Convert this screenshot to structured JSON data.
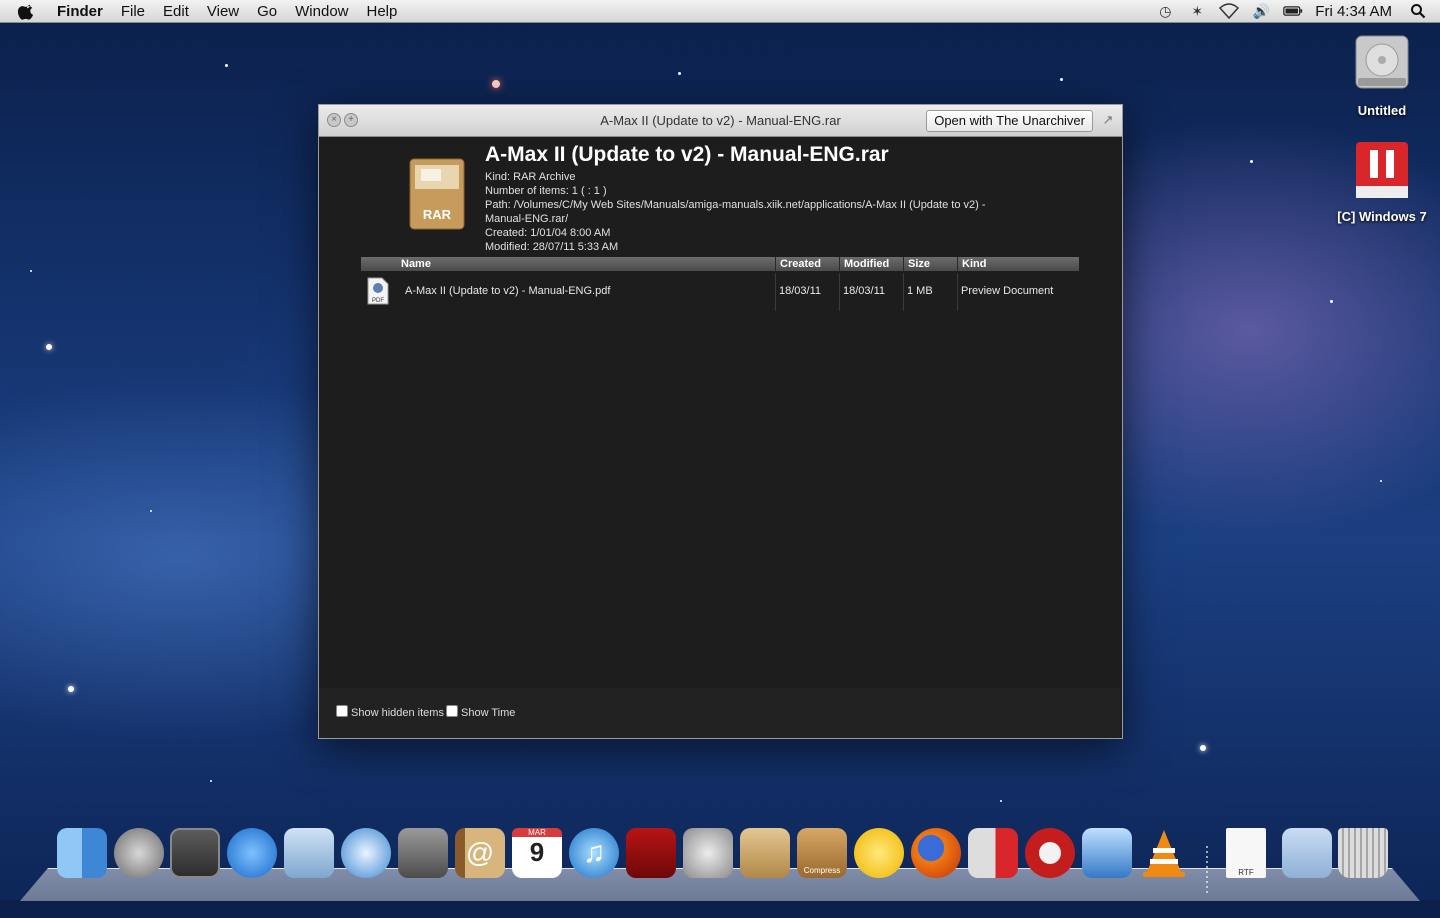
{
  "menubar": {
    "app_name": "Finder",
    "items": [
      "File",
      "Edit",
      "View",
      "Go",
      "Window",
      "Help"
    ],
    "status_icons": [
      "time-machine-icon",
      "bluetooth-icon",
      "wifi-icon",
      "volume-icon",
      "battery-icon"
    ],
    "clock": "Fri 4:34 AM"
  },
  "desktop": {
    "icons": [
      {
        "label": "Untitled",
        "icon": "hard-drive-icon"
      },
      {
        "label": "[C] Windows 7",
        "icon": "parallels-vm-icon"
      }
    ]
  },
  "quicklook": {
    "title": "A-Max II (Update to v2) - Manual-ENG.rar",
    "open_button": "Open with The Unarchiver",
    "archive": {
      "name": "A-Max II (Update to v2) - Manual-ENG.rar",
      "icon_label": "RAR",
      "kind": "Kind: RAR Archive",
      "items": "Number of items: 1 ( : 1 )",
      "path": "Path: /Volumes/C/My Web Sites/Manuals/amiga-manuals.xiik.net/applications/A-Max II (Update to v2) - Manual-ENG.rar/",
      "created": "Created: 1/01/04 8:00 AM",
      "modified": "Modified: 28/07/11 5:33 AM"
    },
    "table": {
      "headers": [
        "Name",
        "Created",
        "Modified",
        "Size",
        "Kind"
      ],
      "rows": [
        {
          "name": "A-Max II (Update to v2) - Manual-ENG.pdf",
          "created": "18/03/11",
          "modified": "18/03/11",
          "size": "1 MB",
          "kind": "Preview Document",
          "icon_label": "PDF"
        }
      ]
    },
    "footer": {
      "show_hidden": "Show hidden items",
      "show_time": "Show Time"
    }
  },
  "dock": {
    "items": [
      "finder-icon",
      "launchpad-icon",
      "photo-booth-icon",
      "app-store-icon",
      "mail-icon",
      "safari-icon",
      "facetime-icon",
      "address-book-icon",
      "ical-icon",
      "itunes-icon",
      "photo-slideshow-icon",
      "system-preferences-icon",
      "archive-utility-icon",
      "compress-icon",
      "cyberduck-icon",
      "firefox-icon",
      "parallels-icon",
      "disk-utility-icon",
      "toaster-icon",
      "vlc-icon",
      "rtf-document-icon",
      "folder-icon",
      "trash-icon"
    ],
    "compress_label": "Compress",
    "ical_month": "MAR",
    "ical_day": "9",
    "rtf_label": "RTF"
  }
}
